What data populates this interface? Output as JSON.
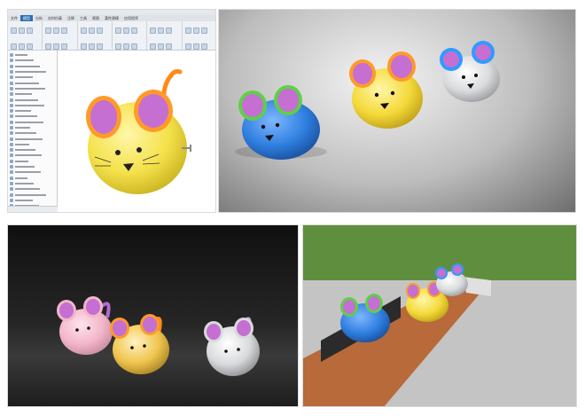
{
  "cad": {
    "tabs": [
      "文件",
      "模型",
      "分析",
      "实时仿真",
      "注释",
      "工具",
      "视图",
      "柔性建模",
      "应用程序"
    ],
    "active_tab_index": 1,
    "tree_rows": 28
  },
  "mice": {
    "yellow": "#f4e14a",
    "blue": "#2f7fe0",
    "gray": "#d9dadc",
    "pink": "#f2b6c9",
    "gold": "#f0c54e",
    "ear_inner": "#c46fd1",
    "ear_rim_orange": "#ff9a2a",
    "ear_rim_green": "#5fcf49",
    "ear_rim_blue": "#2f9bff",
    "tail_orange": "#ff8a1a",
    "tail_green": "#57c84a",
    "tail_purple": "#b76ad0"
  },
  "scene": {
    "grass": "#5f8f3e",
    "bench_wood": "#b86a3a",
    "bench_base": "#d6d6d6",
    "pavement": "#bfbfbf"
  }
}
